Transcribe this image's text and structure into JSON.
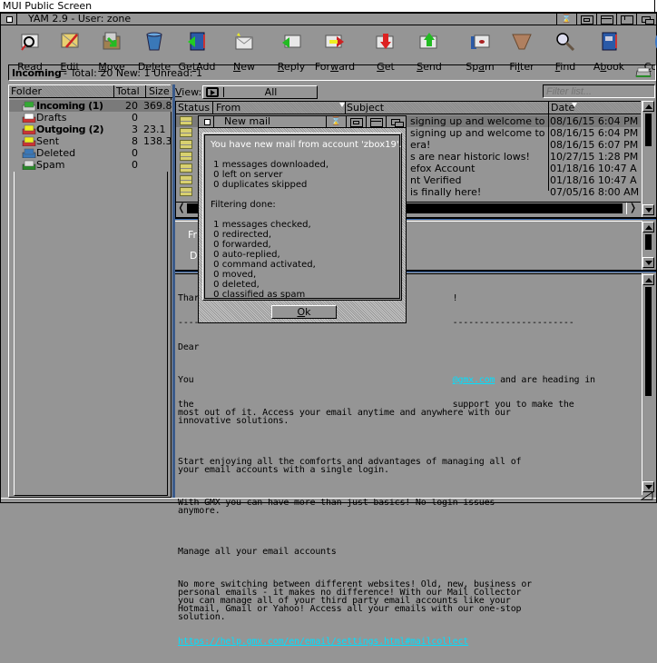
{
  "screen": {
    "title": "MUI Public Screen"
  },
  "window": {
    "title": "YAM 2.9 - User: zone",
    "gadgets": [
      "depth-gadget",
      "zoom-gadget",
      "size-gadget",
      "iconify-gadget"
    ]
  },
  "toolbar": [
    {
      "id": "read",
      "label": "Read",
      "u": 3,
      "icon": "read-icon"
    },
    {
      "id": "edit",
      "label": "Edit",
      "u": 0,
      "icon": "edit-icon"
    },
    {
      "id": "move",
      "label": "Move",
      "u": 0,
      "icon": "move-icon"
    },
    {
      "id": "delete",
      "label": "Delete",
      "u": 2,
      "icon": "delete-icon"
    },
    {
      "id": "getadd",
      "label": "GetAdd",
      "u": 2,
      "icon": "getadd-icon"
    },
    {
      "id": "new",
      "label": "New",
      "u": 0,
      "icon": "new-icon"
    },
    {
      "id": "reply",
      "label": "Reply",
      "u": 0,
      "icon": "reply-icon"
    },
    {
      "id": "forward",
      "label": "Forward",
      "u": 3,
      "icon": "forward-icon"
    },
    {
      "id": "get",
      "label": "Get",
      "u": 0,
      "icon": "get-icon"
    },
    {
      "id": "send",
      "label": "Send",
      "u": 0,
      "icon": "send-icon"
    },
    {
      "id": "spam",
      "label": "Spam",
      "u": 2,
      "icon": "spam-icon"
    },
    {
      "id": "filter",
      "label": "Filter",
      "u": 2,
      "icon": "filter-icon"
    },
    {
      "id": "find",
      "label": "Find",
      "u": 0,
      "icon": "find-icon"
    },
    {
      "id": "abook",
      "label": "Abook",
      "u": 1,
      "icon": "abook-icon"
    },
    {
      "id": "config",
      "label": "Co",
      "u": 0,
      "icon": "config-icon"
    }
  ],
  "status": {
    "folder": "Incoming",
    "stats": "- Total: 20 New: 1 Unread: 1"
  },
  "folders": {
    "headers": {
      "folder": "Folder",
      "total": "Total",
      "size": "Size"
    },
    "items": [
      {
        "name": "Incoming (1)",
        "total": "20",
        "size": "369.8",
        "bold": true,
        "selected": true,
        "icon": "incoming-folder-icon"
      },
      {
        "name": "Drafts",
        "total": "0",
        "size": "",
        "bold": false,
        "icon": "drafts-folder-icon"
      },
      {
        "name": "Outgoing (2)",
        "total": "3",
        "size": "23.1",
        "bold": true,
        "icon": "outgoing-folder-icon"
      },
      {
        "name": "Sent",
        "total": "8",
        "size": "138.3",
        "bold": false,
        "icon": "sent-folder-icon"
      },
      {
        "name": "Deleted",
        "total": "0",
        "size": "",
        "bold": false,
        "icon": "deleted-folder-icon"
      },
      {
        "name": "Spam",
        "total": "0",
        "size": "",
        "bold": false,
        "icon": "spam-folder-icon"
      }
    ]
  },
  "view": {
    "label": "View:",
    "value": "All",
    "filter_placeholder": "Filter list..."
  },
  "messages": {
    "headers": {
      "status": "Status",
      "from": "From",
      "subject": "Subject",
      "date": "Date"
    },
    "rows": [
      {
        "subject": "signing up and welcome to G...",
        "date": "08/16/15 6:04 PM",
        "selected": true
      },
      {
        "subject": "signing up and welcome to G...",
        "date": "08/16/15 6:04 PM"
      },
      {
        "subject": "era!",
        "date": "08/16/15 6:07 PM"
      },
      {
        "subject": "s are near historic lows!",
        "date": "10/27/15 1:28 PM"
      },
      {
        "subject": "efox Account",
        "date": "01/18/16 10:47 A"
      },
      {
        "subject": "nt Verified",
        "date": "01/18/16 10:47 A"
      },
      {
        "subject": "is finally here!",
        "date": "07/05/16 8:00 AM"
      }
    ]
  },
  "header_pane": {
    "from_label": "Fr",
    "date_label": "D"
  },
  "body": {
    "lines": [
      "Thar                                                !",
      "----                                                -----------------------",
      "Dear"
    ],
    "para1_pre": "You                                                 ",
    "para1_link": "@gmx.com",
    "para1_post": " and are heading in",
    "para1_rest": "the                                                 support you to make the\nmost out of it. Access your email anytime and anywhere with our\ninnovative solutions.",
    "para2": "Start enjoying all the comforts and advantages of managing all of\nyour email accounts with a single login.",
    "para3": "With GMX you can have more than just basics! No login issues\nanymore.",
    "para4": "Manage all your email accounts",
    "para5": "No more switching between different websites! Old, new, business or\npersonal emails - it makes no difference! With our Mail Collector\nyou can manage all of your third party email accounts like your\nHotmail, Gmail or Yahoo! Access all your emails with our one-stop\nsolution.",
    "link": "https://help.gmx.com/en/email/settings.html#mailcollect"
  },
  "dialog": {
    "title": "New mail",
    "headline": "You have new mail from account 'zbox19'.",
    "download_summary": " 1 messages downloaded,\n 0 left on server\n 0 duplicates skipped",
    "filter_heading": "Filtering done:",
    "filter_summary": " 1 messages checked,\n 0 redirected,\n 0 forwarded,\n 0 auto-replied,\n 0 command activated,\n 0 moved,\n 0 deleted,\n 0 classified as spam",
    "ok_label": "Ok"
  },
  "colors": {
    "background": "#959595",
    "selection": "#7a7a7a",
    "link": "#00e0ff",
    "splitter": "#3a5a8a"
  }
}
